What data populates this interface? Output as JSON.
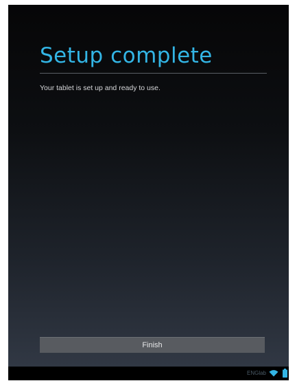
{
  "setup": {
    "title": "Setup complete",
    "message": "Your tablet is set up and ready to use.",
    "finish_label": "Finish"
  },
  "status_bar": {
    "carrier": "ENGlab",
    "icons": [
      "wifi-icon",
      "battery-icon"
    ]
  },
  "colors": {
    "accent": "#33b5e5",
    "button_bg": "#585b60",
    "background_top": "#060607",
    "background_bottom": "#313844"
  }
}
